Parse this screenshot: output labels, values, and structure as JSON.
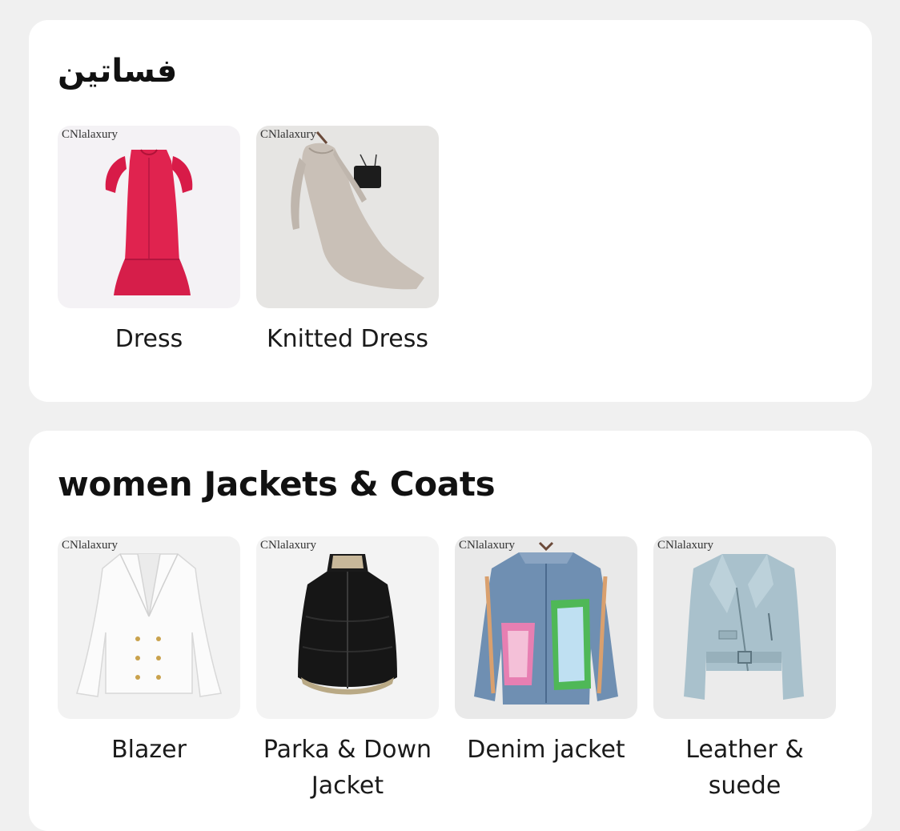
{
  "sections": [
    {
      "title": "فساتين",
      "items": [
        {
          "label": "Dress",
          "watermark": "CNlalaxury",
          "icon": "red-dress-image"
        },
        {
          "label": "Knitted Dress",
          "watermark": "CNlalaxury",
          "icon": "knitted-dress-image"
        }
      ]
    },
    {
      "title": "women Jackets & Coats",
      "items": [
        {
          "label": "Blazer",
          "watermark": "CNlalaxury",
          "icon": "blazer-image"
        },
        {
          "label": "Parka & Down Jacket",
          "watermark": "CNlalaxury",
          "icon": "puffer-vest-image"
        },
        {
          "label": "Denim jacket",
          "watermark": "CNlalaxury",
          "icon": "denim-jacket-image"
        },
        {
          "label": "Leather & suede",
          "watermark": "CNlalaxury",
          "icon": "leather-jacket-image"
        }
      ]
    }
  ],
  "colors": {
    "page_bg": "#f0f0f0",
    "card_bg": "#ffffff",
    "title": "#111111",
    "label": "#1a1a1a"
  }
}
